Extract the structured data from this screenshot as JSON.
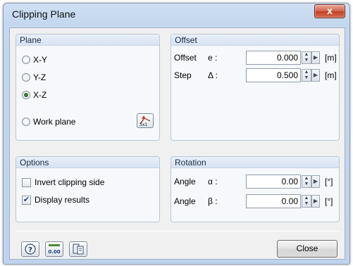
{
  "window": {
    "title": "Clipping Plane",
    "close_glyph": "x"
  },
  "plane": {
    "title": "Plane",
    "options": [
      {
        "label": "X-Y",
        "checked": false
      },
      {
        "label": "Y-Z",
        "checked": false
      },
      {
        "label": "X-Z",
        "checked": true
      },
      {
        "label": "Work plane",
        "checked": false
      }
    ],
    "work_plane_icon": "work-plane-pick-icon"
  },
  "offset": {
    "title": "Offset",
    "rows": [
      {
        "label": "Offset",
        "symbol": "e :",
        "value": "0.000",
        "unit": "[m]"
      },
      {
        "label": "Step",
        "symbol": "Δ :",
        "value": "0.500",
        "unit": "[m]"
      }
    ]
  },
  "options": {
    "title": "Options",
    "items": [
      {
        "label": "Invert clipping side",
        "checked": false
      },
      {
        "label": "Display results",
        "checked": true
      }
    ]
  },
  "rotation": {
    "title": "Rotation",
    "rows": [
      {
        "label": "Angle",
        "symbol": "α :",
        "value": "0.00",
        "unit": "[°]"
      },
      {
        "label": "Angle",
        "symbol": "β :",
        "value": "0.00",
        "unit": "[°]"
      }
    ]
  },
  "footer": {
    "close_label": "Close",
    "icons": [
      "help-icon",
      "units-icon",
      "copy-settings-icon"
    ],
    "units_icon_text": "0.00"
  }
}
